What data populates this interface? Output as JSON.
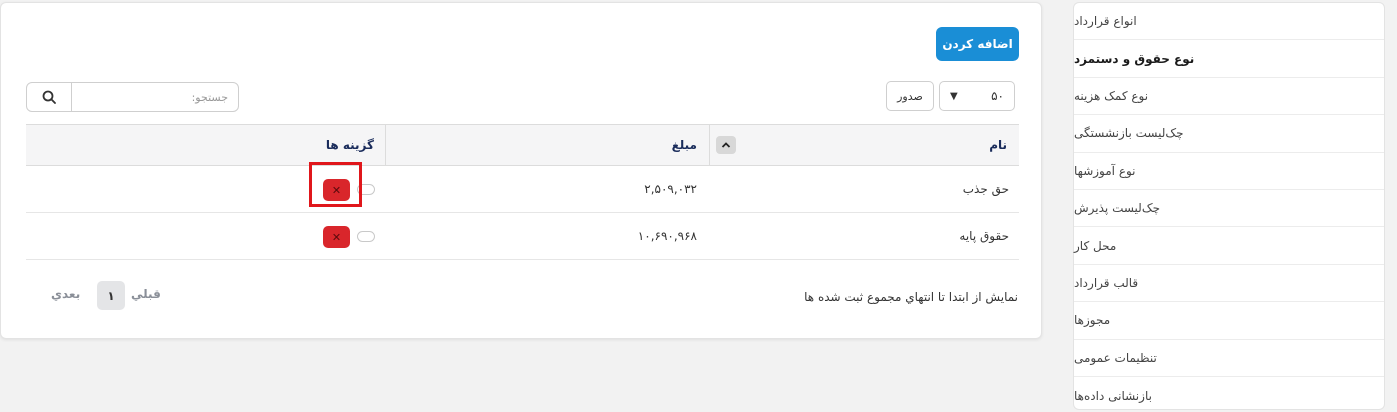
{
  "toolbar": {
    "add_label": "اضافه کردن",
    "length_value": "۵۰",
    "export_label": "صدور",
    "search_placeholder": "جستجو:"
  },
  "table": {
    "columns": [
      "نام",
      "مبلغ",
      "گزینه ها"
    ],
    "rows": [
      {
        "name": "حق جذب",
        "amount": "۲,۵۰۹,۰۳۲"
      },
      {
        "name": "حقوق پایه",
        "amount": "۱۰,۶۹۰,۹۶۸"
      }
    ]
  },
  "footer": {
    "info": "نمایش از ابتدا تا انتهاي مجموع ثبت شده ها",
    "prev": "قبلي",
    "current_page": "۱",
    "next": "بعدي"
  },
  "sidebar": {
    "items": [
      {
        "label": "انواع قرارداد"
      },
      {
        "label": "نوع حقوق و دستمزد"
      },
      {
        "label": "نوع کمک هزینه"
      },
      {
        "label": "چک‌لیست بازنشستگی"
      },
      {
        "label": "نوع آموزشها"
      },
      {
        "label": "چک‌لیست پذیرش"
      },
      {
        "label": "محل کار"
      },
      {
        "label": "قالب قرارداد"
      },
      {
        "label": "مجوزها"
      },
      {
        "label": "تنظیمات عمومی"
      },
      {
        "label": "بازنشانی داده‌ها"
      }
    ]
  },
  "colors": {
    "primary": "#1a8ed6",
    "danger": "#d9262b",
    "highlight": "#e0161b",
    "header_text": "#1a2c5b"
  }
}
